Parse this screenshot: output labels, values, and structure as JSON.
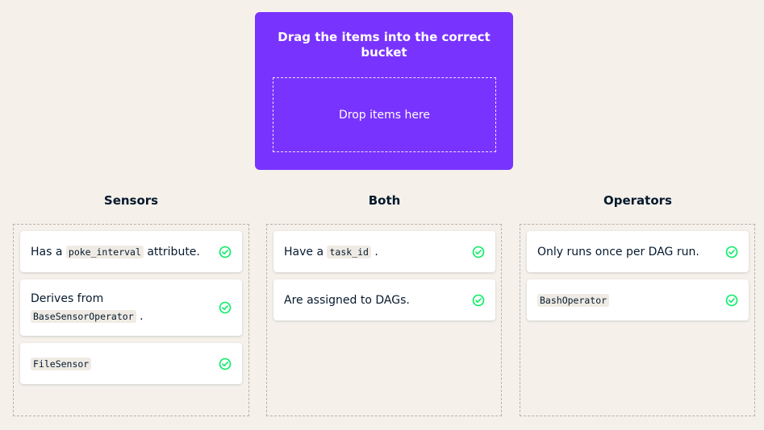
{
  "prompt": {
    "title": "Drag the items into the correct bucket",
    "drop_label": "Drop items here"
  },
  "accent_color": "#7933ff",
  "correct_color": "#03ef62",
  "buckets": [
    {
      "title": "Sensors",
      "items": [
        {
          "pre": "Has a ",
          "code": "poke_interval",
          "post": " attribute.",
          "status": "correct"
        },
        {
          "pre": "Derives from ",
          "code": "BaseSensorOperator",
          "post": " .",
          "status": "correct"
        },
        {
          "pre": "",
          "code": "FileSensor",
          "post": "",
          "status": "correct"
        }
      ]
    },
    {
      "title": "Both",
      "items": [
        {
          "pre": "Have a ",
          "code": "task_id",
          "post": " .",
          "status": "correct"
        },
        {
          "pre": "Are assigned to DAGs.",
          "code": "",
          "post": "",
          "status": "correct"
        }
      ]
    },
    {
      "title": "Operators",
      "items": [
        {
          "pre": "Only runs once per DAG run.",
          "code": "",
          "post": "",
          "status": "correct"
        },
        {
          "pre": "",
          "code": "BashOperator",
          "post": "",
          "status": "correct"
        }
      ]
    }
  ],
  "icons": {
    "check": "check-circle-icon"
  }
}
